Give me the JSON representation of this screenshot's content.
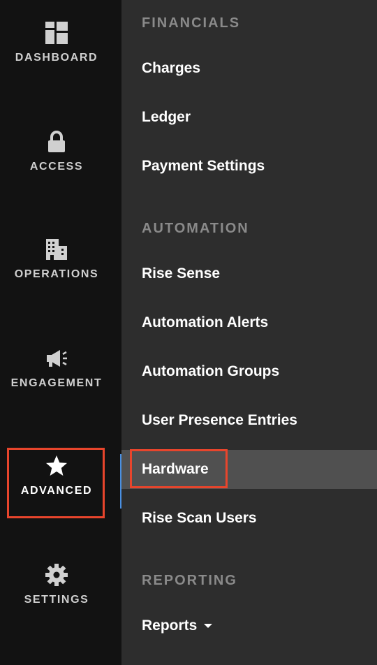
{
  "rail": {
    "items": [
      {
        "label": "DASHBOARD",
        "icon": "dashboard-icon"
      },
      {
        "label": "ACCESS",
        "icon": "lock-icon"
      },
      {
        "label": "OPERATIONS",
        "icon": "building-icon"
      },
      {
        "label": "ENGAGEMENT",
        "icon": "megaphone-icon"
      },
      {
        "label": "ADVANCED",
        "icon": "star-icon",
        "active": true
      },
      {
        "label": "SETTINGS",
        "icon": "gear-icon"
      }
    ]
  },
  "menu": {
    "financials_title": "FINANCIALS",
    "financials": [
      "Charges",
      "Ledger",
      "Payment Settings"
    ],
    "automation_title": "AUTOMATION",
    "automation": [
      "Rise Sense",
      "Automation Alerts",
      "Automation Groups",
      "User Presence Entries",
      "Hardware",
      "Rise Scan Users"
    ],
    "reporting_title": "REPORTING",
    "reports_label": "Reports",
    "active_item": "Hardware"
  },
  "colors": {
    "rail_bg": "#121212",
    "panel_bg": "#2d2d2d",
    "active_row_bg": "#505050",
    "highlight_box": "#e8452c",
    "section_text": "#8a8a8a"
  }
}
